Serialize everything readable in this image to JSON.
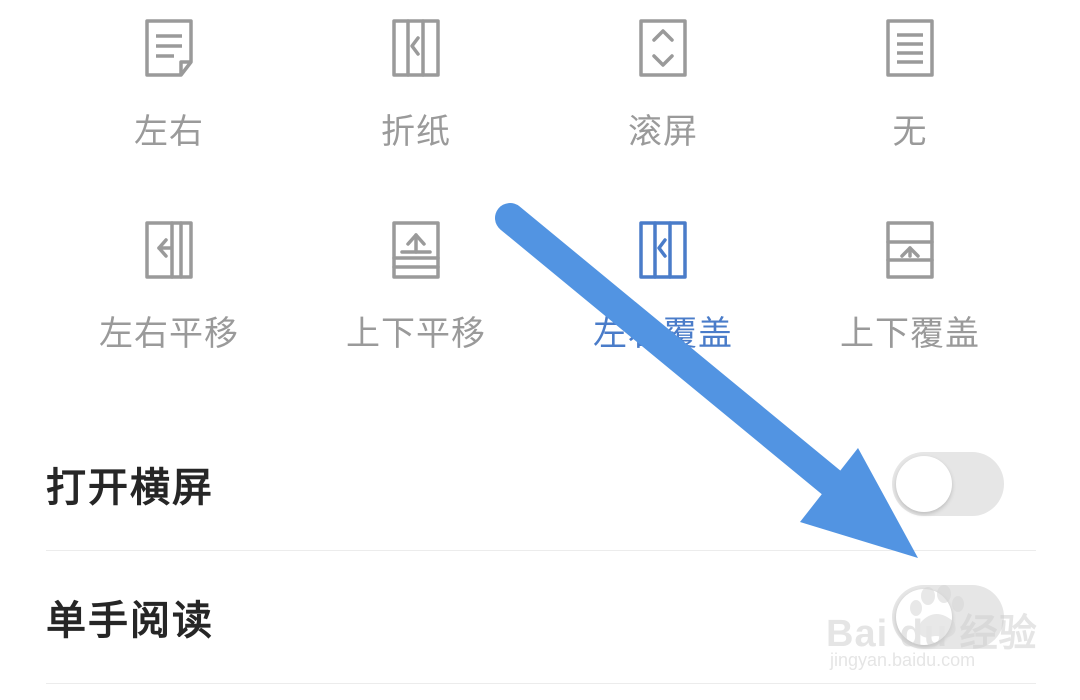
{
  "page_turn_modes": [
    {
      "label": "左右",
      "icon": "page-curl-icon",
      "selected": false
    },
    {
      "label": "折纸",
      "icon": "fold-icon",
      "selected": false
    },
    {
      "label": "滚屏",
      "icon": "scroll-icon",
      "selected": false
    },
    {
      "label": "无",
      "icon": "no-effect-icon",
      "selected": false
    },
    {
      "label": "左右平移",
      "icon": "horizontal-slide-icon",
      "selected": false
    },
    {
      "label": "上下平移",
      "icon": "vertical-slide-icon",
      "selected": false
    },
    {
      "label": "左右覆盖",
      "icon": "horizontal-cover-icon",
      "selected": true
    },
    {
      "label": "上下覆盖",
      "icon": "vertical-cover-icon",
      "selected": false
    }
  ],
  "settings": [
    {
      "label": "打开横屏",
      "enabled": false
    },
    {
      "label": "单手阅读",
      "enabled": false
    }
  ],
  "colors": {
    "selected": "#4a7cc9",
    "icon_default": "#9a9a9a",
    "label_default": "#9a9a9a",
    "toggle_off": "#e6e6e6",
    "arrow": "#5294e2"
  },
  "watermark": {
    "main": "Bai du 经验",
    "sub": "jingyan.baidu.com"
  }
}
